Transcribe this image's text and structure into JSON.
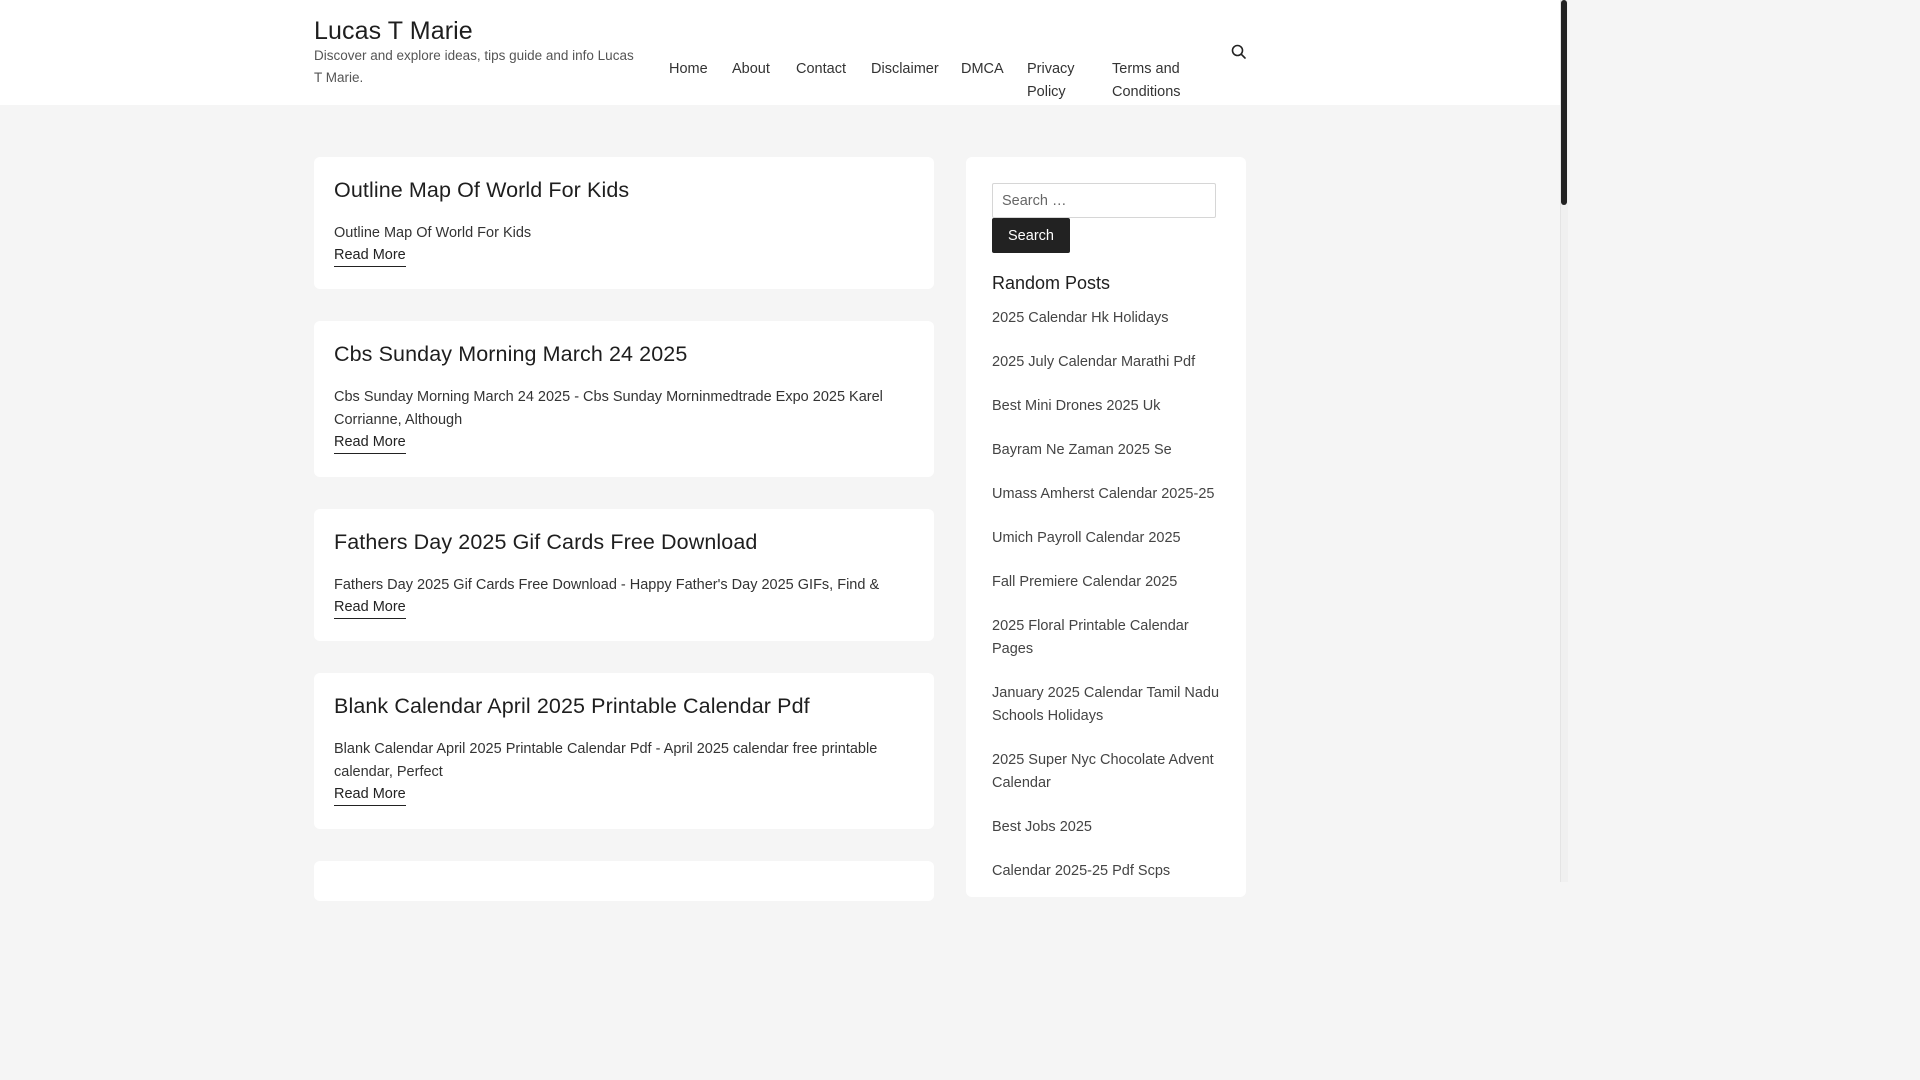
{
  "header": {
    "site_title": "Lucas T Marie",
    "site_description": "Discover and explore ideas, tips guide and info Lucas T Marie.",
    "nav": [
      {
        "label": "Home"
      },
      {
        "label": "About"
      },
      {
        "label": "Contact"
      },
      {
        "label": "Disclaimer"
      },
      {
        "label": "DMCA"
      },
      {
        "label": "Privacy Policy"
      },
      {
        "label": "Terms and Conditions"
      }
    ],
    "search_icon": "search-icon"
  },
  "posts": [
    {
      "title": "Outline Map Of World For Kids",
      "excerpt": "Outline Map Of World For Kids",
      "read_more": "Read More"
    },
    {
      "title": "Cbs Sunday Morning March 24 2025",
      "excerpt": "Cbs Sunday Morning March 24 2025 - Cbs Sunday Morninmedtrade Expo 2025 Karel Corrianne, Although",
      "read_more": "Read More"
    },
    {
      "title": "Fathers Day 2025 Gif Cards Free Download",
      "excerpt": "Fathers Day 2025 Gif Cards Free Download - Happy Father's Day 2025 GIFs, Find &",
      "read_more": "Read More"
    },
    {
      "title": "Blank Calendar April 2025 Printable Calendar Pdf",
      "excerpt": "Blank Calendar April 2025 Printable Calendar Pdf - April 2025 calendar free printable calendar, Perfect",
      "read_more": "Read More"
    }
  ],
  "sidebar": {
    "search_placeholder": "Search …",
    "search_button": "Search",
    "random_title": "Random Posts",
    "random_posts": [
      "2025 Calendar Hk Holidays",
      "2025 July Calendar Marathi Pdf",
      "Best Mini Drones 2025 Uk",
      "Bayram Ne Zaman 2025 Se",
      "Umass Amherst Calendar 2025-25",
      "Umich Payroll Calendar 2025",
      "Fall Premiere Calendar 2025",
      "2025 Floral Printable Calendar Pages",
      "January 2025 Calendar Tamil Nadu Schools Holidays",
      "2025 Super Nyc Chocolate Advent Calendar",
      "Best Jobs 2025",
      "Calendar 2025-25 Pdf Scps"
    ]
  },
  "colors": {
    "background": "#f5f5f5",
    "card": "#ffffff",
    "text": "#222222",
    "button": "#222222"
  }
}
